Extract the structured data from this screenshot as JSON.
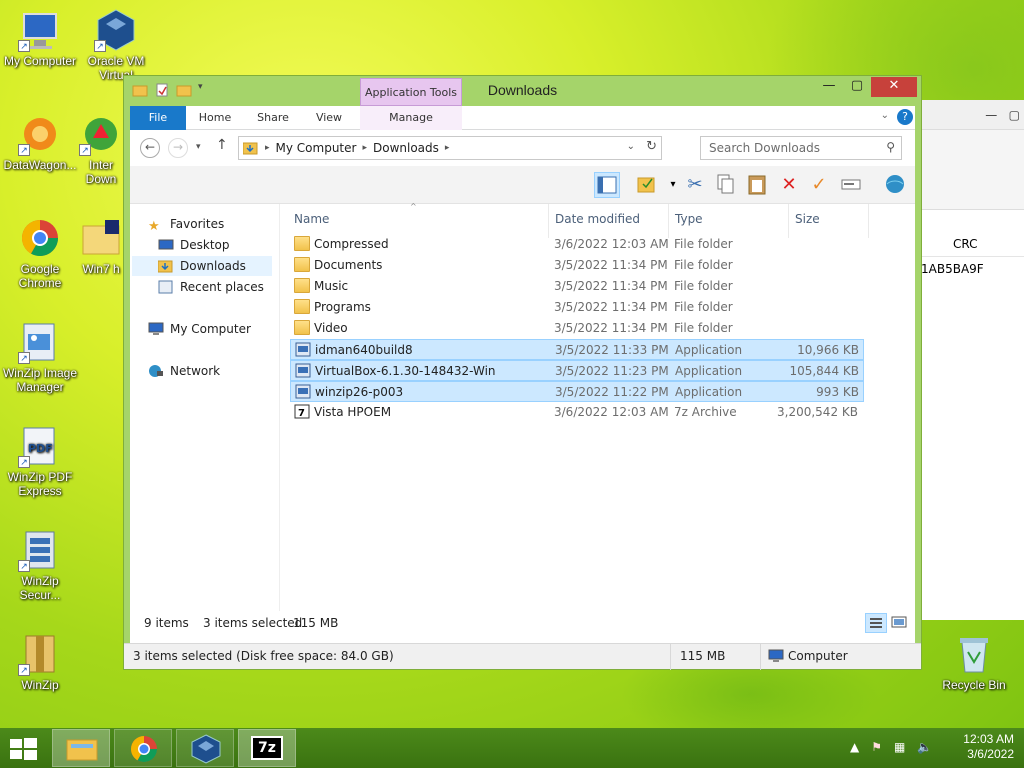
{
  "desktop": {
    "icons": [
      {
        "label": "My Computer"
      },
      {
        "label": "Oracle VM Virtual"
      },
      {
        "label": "DataWagon..."
      },
      {
        "label": "Inter Down"
      },
      {
        "label": "Google Chrome"
      },
      {
        "label": "Win7 h"
      },
      {
        "label": "WinZip Image Manager"
      },
      {
        "label": "WinZip PDF Express"
      },
      {
        "label": "WinZip Secur..."
      },
      {
        "label": "WinZip"
      },
      {
        "label": "Recycle Bin"
      }
    ]
  },
  "background_window": {
    "crc_header": "CRC",
    "crc_value": "1AB5BA9F"
  },
  "explorer": {
    "title": "Downloads",
    "app_tools_label": "Application Tools",
    "tabs": {
      "file": "File",
      "home": "Home",
      "share": "Share",
      "view": "View",
      "manage": "Manage"
    },
    "address": {
      "root": "My Computer",
      "current": "Downloads"
    },
    "search_placeholder": "Search Downloads",
    "navpane": {
      "favorites": "Favorites",
      "desktop": "Desktop",
      "downloads": "Downloads",
      "recent": "Recent places",
      "computer": "My Computer",
      "network": "Network"
    },
    "columns": {
      "name": "Name",
      "date": "Date modified",
      "type": "Type",
      "size": "Size"
    },
    "files": [
      {
        "name": "Compressed",
        "date": "3/6/2022 12:03 AM",
        "type": "File folder",
        "size": "",
        "kind": "folder",
        "selected": false
      },
      {
        "name": "Documents",
        "date": "3/5/2022 11:34 PM",
        "type": "File folder",
        "size": "",
        "kind": "folder",
        "selected": false
      },
      {
        "name": "Music",
        "date": "3/5/2022 11:34 PM",
        "type": "File folder",
        "size": "",
        "kind": "folder",
        "selected": false
      },
      {
        "name": "Programs",
        "date": "3/5/2022 11:34 PM",
        "type": "File folder",
        "size": "",
        "kind": "folder",
        "selected": false
      },
      {
        "name": "Video",
        "date": "3/5/2022 11:34 PM",
        "type": "File folder",
        "size": "",
        "kind": "folder",
        "selected": false
      },
      {
        "name": "idman640build8",
        "date": "3/5/2022 11:33 PM",
        "type": "Application",
        "size": "10,966 KB",
        "kind": "app",
        "selected": true
      },
      {
        "name": "VirtualBox-6.1.30-148432-Win",
        "date": "3/5/2022 11:23 PM",
        "type": "Application",
        "size": "105,844 KB",
        "kind": "app",
        "selected": true
      },
      {
        "name": "winzip26-p003",
        "date": "3/5/2022 11:22 PM",
        "type": "Application",
        "size": "993 KB",
        "kind": "app",
        "selected": true
      },
      {
        "name": "Vista HPOEM",
        "date": "3/6/2022 12:03 AM",
        "type": "7z Archive",
        "size": "3,200,542 KB",
        "kind": "archive",
        "selected": false
      }
    ],
    "status": {
      "count": "9 items",
      "selected": "3 items selected",
      "selected_size": "115 MB",
      "detail": "3 items selected (Disk free space: 84.0 GB)",
      "detail_size": "115 MB",
      "location": "Computer"
    }
  },
  "taskbar": {
    "time": "12:03 AM",
    "date": "3/6/2022",
    "seven_zip_label": "7z"
  },
  "colors": {
    "selection": "#cce8ff",
    "file_tab": "#1979ca",
    "close_button": "#c7413b",
    "app_tools": "#e7c6ef"
  }
}
